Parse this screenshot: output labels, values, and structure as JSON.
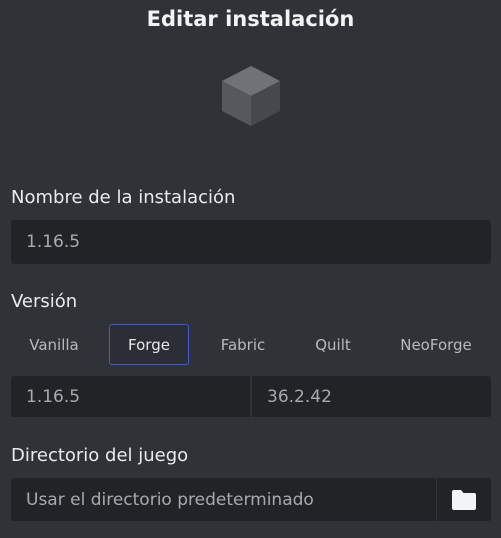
{
  "dialog": {
    "title": "Editar instalación"
  },
  "name_section": {
    "label": "Nombre de la instalación",
    "value": "1.16.5"
  },
  "version_section": {
    "label": "Versión",
    "loaders": [
      {
        "label": "Vanilla",
        "selected": false
      },
      {
        "label": "Forge",
        "selected": true
      },
      {
        "label": "Fabric",
        "selected": false
      },
      {
        "label": "Quilt",
        "selected": false
      },
      {
        "label": "NeoForge",
        "selected": false
      }
    ],
    "game_version": "1.16.5",
    "loader_version": "36.2.42"
  },
  "directory_section": {
    "label": "Directorio del juego",
    "placeholder": "Usar el directorio predeterminado"
  },
  "icons": {
    "installation_icon": "cube-icon",
    "folder_icon": "folder-icon"
  },
  "colors": {
    "background": "#2f3236",
    "field": "#212327",
    "accent": "#3b5bd8"
  }
}
